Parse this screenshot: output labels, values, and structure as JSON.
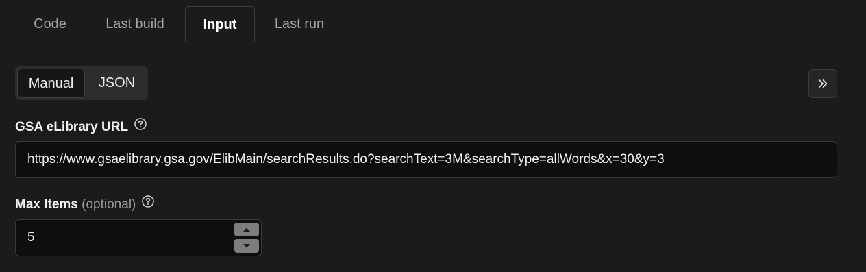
{
  "tabs": [
    {
      "label": "Code",
      "active": false
    },
    {
      "label": "Last build",
      "active": false
    },
    {
      "label": "Input",
      "active": true
    },
    {
      "label": "Last run",
      "active": false
    }
  ],
  "mode_toggle": {
    "options": [
      "Manual",
      "JSON"
    ],
    "selected": "Manual"
  },
  "collapse_button": {
    "icon": "chevrons-right-icon"
  },
  "fields": {
    "url": {
      "label": "GSA eLibrary URL",
      "help_icon": "help-circle-icon",
      "value": "https://www.gsaelibrary.gsa.gov/ElibMain/searchResults.do?searchText=3M&searchType=allWords&x=30&y=3"
    },
    "max_items": {
      "label": "Max Items",
      "optional_note": "(optional)",
      "help_icon": "help-circle-icon",
      "value": "5"
    }
  },
  "colors": {
    "background": "#1b1b1b",
    "input_background": "#0e0e0e",
    "border": "#3a3a3a",
    "text": "#f2f2f2",
    "muted_text": "#a6a6a6"
  }
}
